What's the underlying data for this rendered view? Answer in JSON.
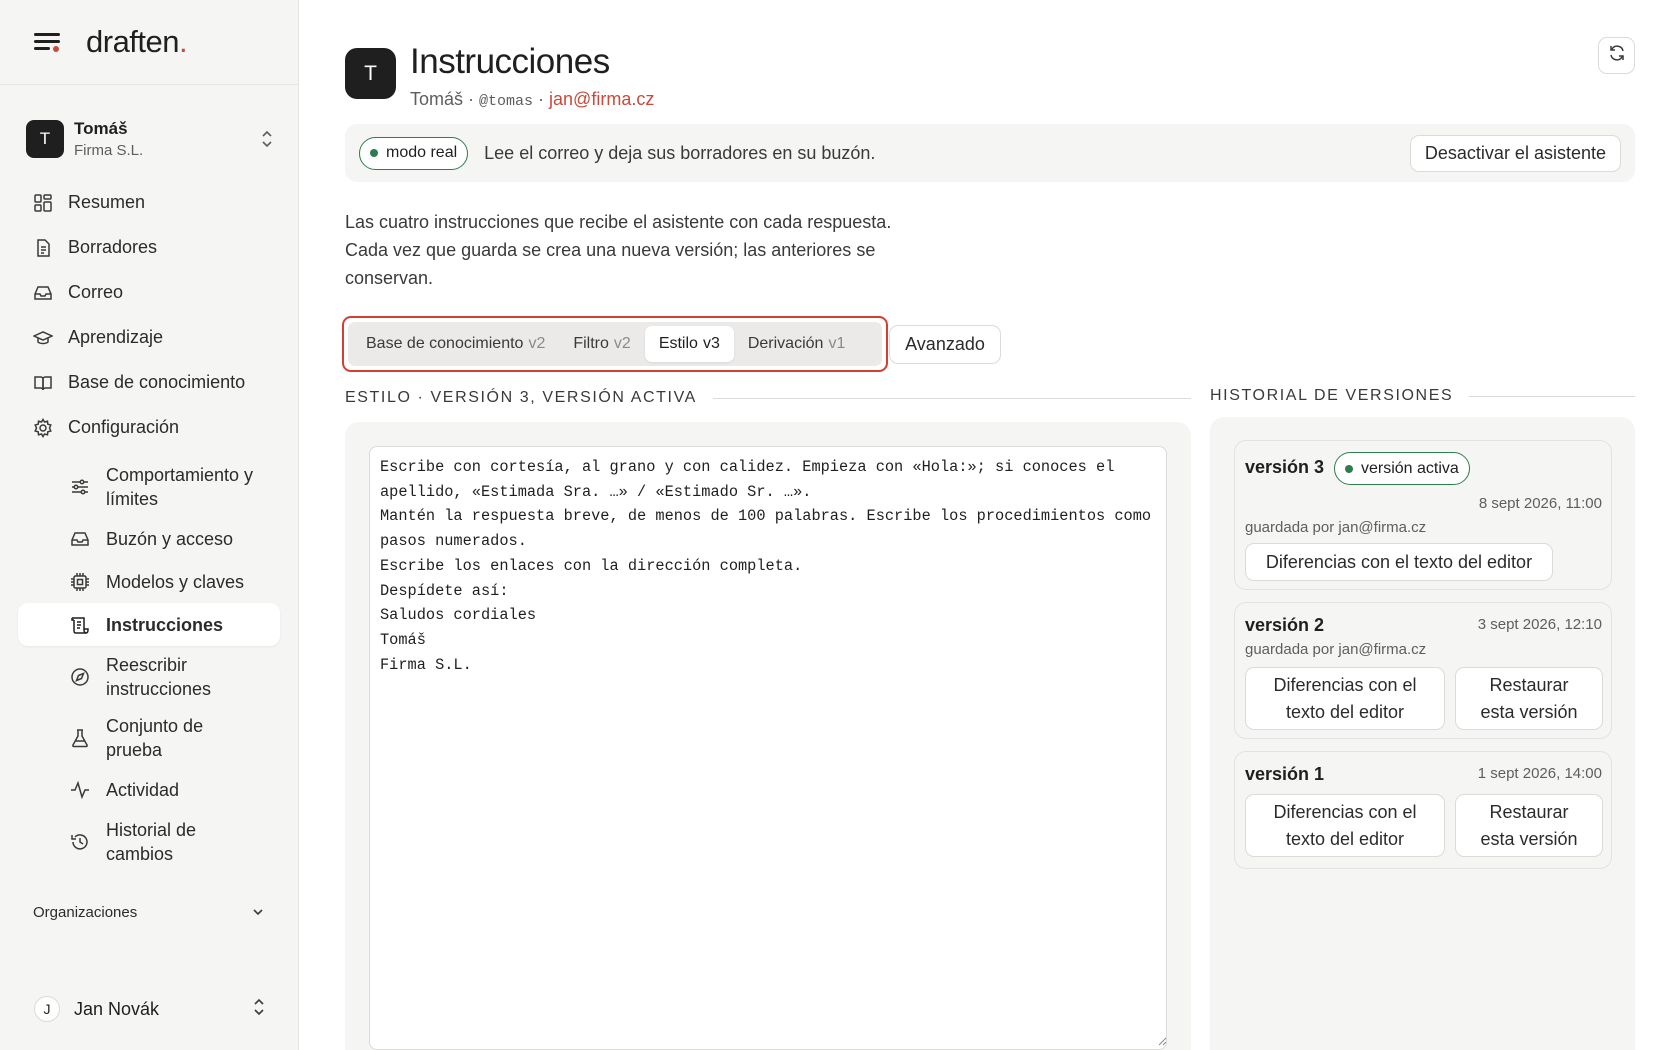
{
  "app": {
    "brand": "draften",
    "brand_dot": "."
  },
  "account": {
    "avatar_letter": "T",
    "name": "Tomáš",
    "org": "Firma S.L."
  },
  "nav": {
    "items": [
      {
        "label": "Resumen",
        "icon": "grid-icon"
      },
      {
        "label": "Borradores",
        "icon": "document-icon"
      },
      {
        "label": "Correo",
        "icon": "inbox-icon"
      },
      {
        "label": "Aprendizaje",
        "icon": "graduation-cap-icon"
      },
      {
        "label": "Base de conocimiento",
        "icon": "book-icon"
      },
      {
        "label": "Configuración",
        "icon": "gear-icon"
      }
    ],
    "sub_items": [
      {
        "label": "Comportamiento y límites",
        "icon": "sliders-icon"
      },
      {
        "label": "Buzón y acceso",
        "icon": "inbox-icon"
      },
      {
        "label": "Modelos y claves",
        "icon": "chip-icon"
      },
      {
        "label": "Instrucciones",
        "icon": "scroll-icon",
        "active": true
      },
      {
        "label": "Reescribir instrucciones",
        "icon": "compass-icon"
      },
      {
        "label": "Conjunto de prueba",
        "icon": "flask-icon"
      },
      {
        "label": "Actividad",
        "icon": "activity-icon"
      },
      {
        "label": "Historial de cambios",
        "icon": "history-icon"
      }
    ],
    "organizations_label": "Organizaciones"
  },
  "user": {
    "avatar_letter": "J",
    "name": "Jan Novák"
  },
  "header": {
    "avatar_letter": "T",
    "title": "Instrucciones",
    "name": "Tomáš",
    "sep1": " · ",
    "handle": "@tomas",
    "sep2": " · ",
    "email": "jan@firma.cz"
  },
  "banner": {
    "badge": "modo real",
    "text": "Lee el correo y deja sus borradores en su buzón.",
    "button": "Desactivar el asistente"
  },
  "description": {
    "line1": "Las cuatro instrucciones que recibe el asistente con cada respuesta.",
    "line2": "Cada vez que guarda se crea una nueva versión; las anteriores se",
    "line3": "conservan."
  },
  "tabs": [
    {
      "label": "Base de conocimiento",
      "ver": "v2"
    },
    {
      "label": "Filtro",
      "ver": "v2"
    },
    {
      "label": "Estilo",
      "ver": "v3",
      "active": true
    },
    {
      "label": "Derivación",
      "ver": "v1"
    }
  ],
  "advanced_button": "Avanzado",
  "editor": {
    "section_label": "ESTILO · VERSIÓN 3, VERSIÓN ACTIVA",
    "text": "Escribe con cortesía, al grano y con calidez. Empieza con «Hola:»; si conoces el apellido, «Estimada Sra. …» / «Estimado Sr. …».\nMantén la respuesta breve, de menos de 100 palabras. Escribe los procedimientos como pasos numerados.\nEscribe los enlaces con la dirección completa.\nDespídete así:\nSaludos cordiales\nTomáš\nFirma S.L."
  },
  "history": {
    "section_label": "HISTORIAL DE VERSIONES",
    "versions": [
      {
        "title": "versión 3",
        "badge": "versión activa",
        "date": "8 sept 2026, 11:00",
        "by": "guardada por jan@firma.cz",
        "diff": "Diferencias con el texto del editor"
      },
      {
        "title": "versión 2",
        "date": "3 sept 2026, 12:10",
        "by": "guardada por jan@firma.cz",
        "diff": "Diferencias con el texto del editor",
        "restore": "Restaurar esta versión"
      },
      {
        "title": "versión 1",
        "date": "1 sept 2026, 14:00",
        "diff": "Diferencias con el texto del editor",
        "restore": "Restaurar esta versión"
      }
    ]
  },
  "colors": {
    "accent": "#c94a3a",
    "live_green": "#2e7d4f",
    "highlight_red": "#d4402e"
  }
}
